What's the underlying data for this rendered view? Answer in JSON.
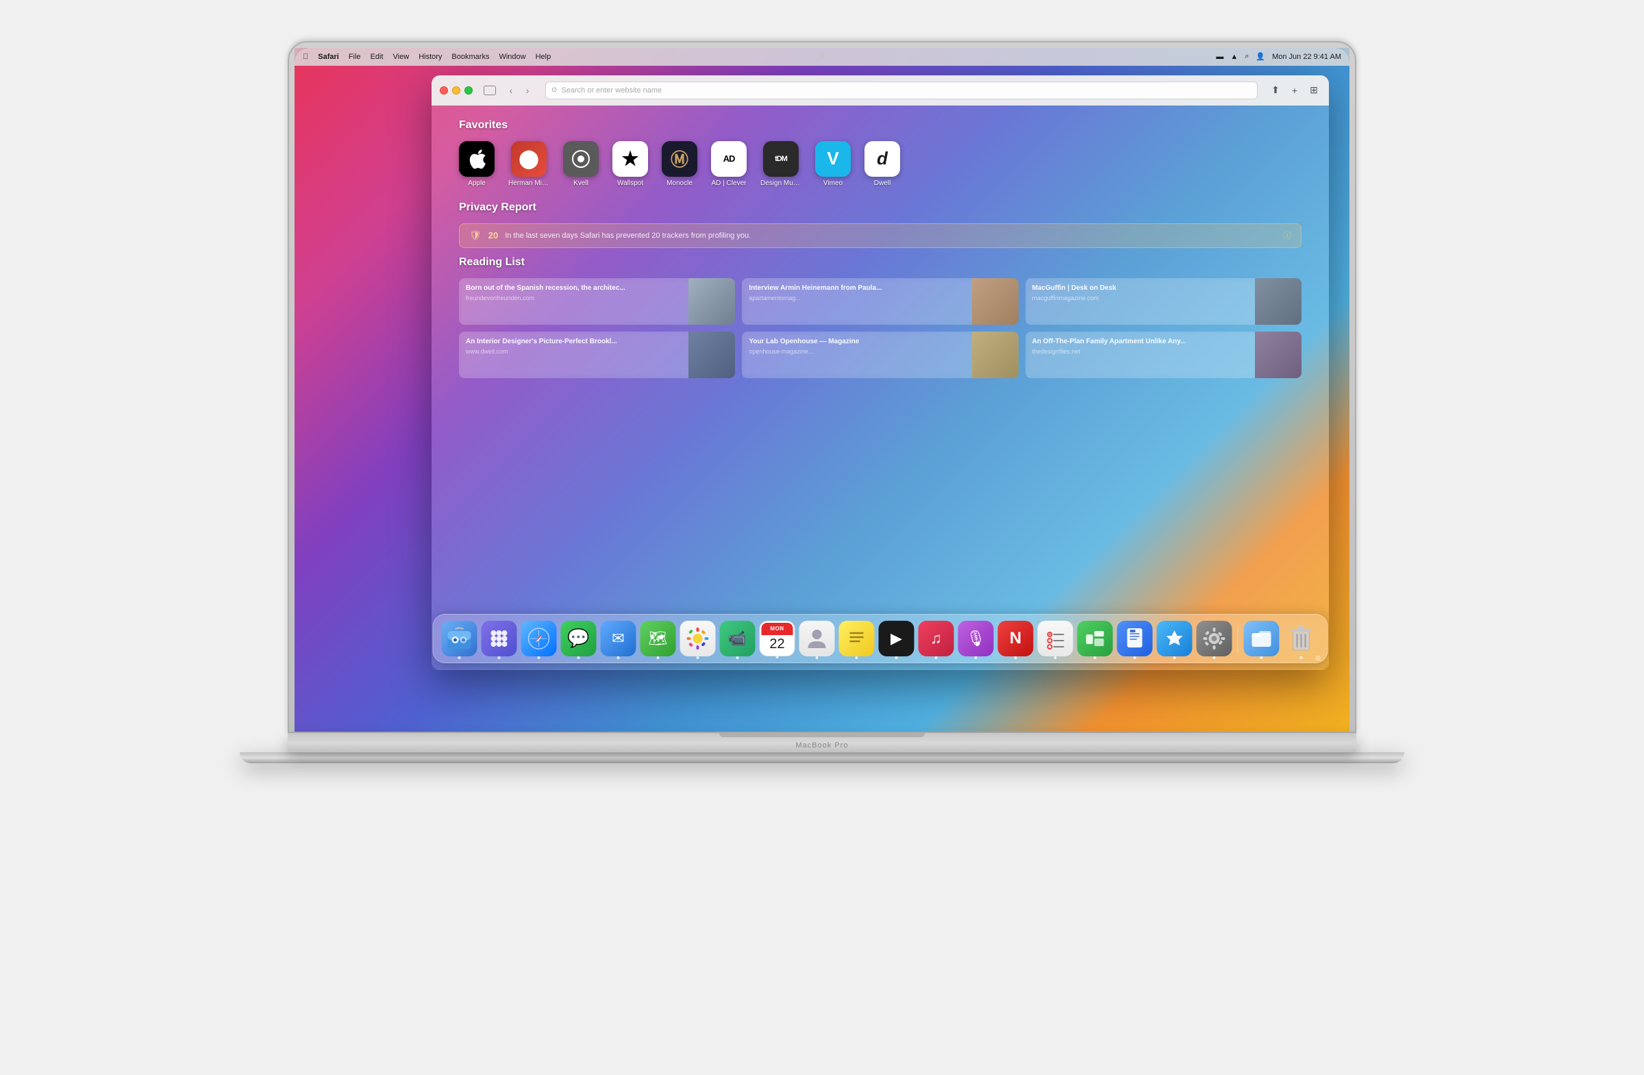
{
  "page": {
    "bg_color": "#f0f0f0"
  },
  "macbook": {
    "model_label": "MacBook Pro"
  },
  "menubar": {
    "app_name": "Safari",
    "items": [
      "File",
      "Edit",
      "View",
      "History",
      "Bookmarks",
      "Window",
      "Help"
    ],
    "time": "Mon Jun 22  9:41 AM"
  },
  "safari": {
    "address_placeholder": "Search or enter website name",
    "nav_back": "‹",
    "nav_forward": "›"
  },
  "favorites": {
    "title": "Favorites",
    "items": [
      {
        "label": "Apple",
        "icon": "🍎",
        "class": "fav-apple"
      },
      {
        "label": "Herman Miller",
        "icon": "⬤",
        "class": "fav-herman"
      },
      {
        "label": "Kvell",
        "icon": "⬤",
        "class": "fav-kvell"
      },
      {
        "label": "Wallspot",
        "icon": "★",
        "class": "fav-wallspot"
      },
      {
        "label": "Monocle",
        "icon": "Ⓜ",
        "class": "fav-monocle"
      },
      {
        "label": "AD | Clever",
        "icon": "AD",
        "class": "fav-ad"
      },
      {
        "label": "Design Museum",
        "icon": "tDM",
        "class": "fav-tdm"
      },
      {
        "label": "Vimeo",
        "icon": "V",
        "class": "fav-vimeo"
      },
      {
        "label": "Dwell",
        "icon": "d",
        "class": "fav-dwell"
      }
    ]
  },
  "privacy": {
    "title": "Privacy Report",
    "icon": "🛡",
    "count": "20",
    "message": "In the last seven days Safari has prevented 20 trackers from profiling you."
  },
  "reading_list": {
    "title": "Reading List",
    "items": [
      {
        "title": "Born out of the Spanish recession, the architec...",
        "url": "freundevonfreunden.com",
        "thumb_class": "thumb1"
      },
      {
        "title": "Interview Armin Heinemann from Paula...",
        "url": "apartamentomag...",
        "thumb_class": "thumb2"
      },
      {
        "title": "MacGuffin | Desk on Desk",
        "url": "macguffinmagazine.com",
        "thumb_class": "thumb3"
      },
      {
        "title": "An Interior Designer's Picture-Perfect Brookl...",
        "url": "www.dwell.com",
        "thumb_class": "thumb4"
      },
      {
        "title": "Your Lab Openhouse — Magazine",
        "url": "openhouse-magazine...",
        "thumb_class": "thumb5"
      },
      {
        "title": "An Off-The-Plan Family Apartment Unlike Any...",
        "url": "thedesignfiles.net",
        "thumb_class": "thumb6"
      }
    ]
  },
  "dock": {
    "icons": [
      {
        "label": "Finder",
        "class": "d-finder",
        "symbol": "😊"
      },
      {
        "label": "Launchpad",
        "class": "d-launchpad",
        "symbol": "⊞"
      },
      {
        "label": "Safari",
        "class": "d-safari",
        "symbol": "🧭"
      },
      {
        "label": "Messages",
        "class": "d-messages",
        "symbol": "💬"
      },
      {
        "label": "Mail",
        "class": "d-mail",
        "symbol": "✉️"
      },
      {
        "label": "Maps",
        "class": "d-maps",
        "symbol": "🗺"
      },
      {
        "label": "Photos",
        "class": "d-photos",
        "symbol": "🖼"
      },
      {
        "label": "FaceTime",
        "class": "d-facetime",
        "symbol": "📹"
      },
      {
        "label": "Calendar",
        "class": "d-calendar",
        "symbol": "22",
        "is_calendar": true
      },
      {
        "label": "Contacts",
        "class": "d-contacts",
        "symbol": "👤"
      },
      {
        "label": "Notes",
        "class": "d-notes",
        "symbol": "📝"
      },
      {
        "label": "Apple TV",
        "class": "d-appletv",
        "symbol": "▶"
      },
      {
        "label": "Music",
        "class": "d-music",
        "symbol": "♫"
      },
      {
        "label": "Podcasts",
        "class": "d-podcasts",
        "symbol": "🎙"
      },
      {
        "label": "News",
        "class": "d-news",
        "symbol": "N"
      },
      {
        "label": "Reminders",
        "class": "d-reminders",
        "symbol": "☑"
      },
      {
        "label": "Numbers",
        "class": "d-numbers",
        "symbol": "≡"
      },
      {
        "label": "Pages",
        "class": "d-pages",
        "symbol": "P"
      },
      {
        "label": "App Store",
        "class": "d-appstore",
        "symbol": "A"
      },
      {
        "label": "System Preferences",
        "class": "d-systemprefs",
        "symbol": "⚙"
      },
      {
        "label": "Finder",
        "class": "d-finder2",
        "symbol": "▣"
      },
      {
        "label": "Trash",
        "class": "d-trash",
        "symbol": "🗑"
      }
    ]
  }
}
